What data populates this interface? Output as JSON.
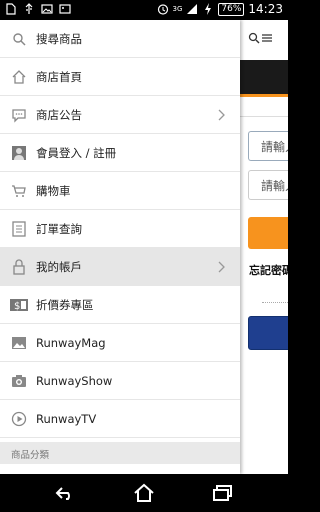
{
  "statusbar": {
    "time": "14:23",
    "battery": "76%",
    "network": "3G"
  },
  "drawer": {
    "items": [
      {
        "label": "搜尋商品",
        "icon": "search-icon"
      },
      {
        "label": "商店首頁",
        "icon": "home-icon"
      },
      {
        "label": "商店公告",
        "icon": "chat-icon"
      },
      {
        "label": "會員登入 / 註冊",
        "icon": "user-icon"
      },
      {
        "label": "購物車",
        "icon": "cart-icon"
      },
      {
        "label": "訂單查詢",
        "icon": "list-icon"
      },
      {
        "label": "我的帳戶",
        "icon": "lock-icon"
      },
      {
        "label": "折價券專區",
        "icon": "coupon-icon"
      },
      {
        "label": "RunwayMag",
        "icon": "image-icon"
      },
      {
        "label": "RunwayShow",
        "icon": "camera-icon"
      },
      {
        "label": "RunwayTV",
        "icon": "play-icon"
      }
    ],
    "section_label": "商品分類"
  },
  "behind": {
    "field1_placeholder": "請輸入",
    "field2_placeholder": "請輸入",
    "forgot_label": "忘記密碼"
  },
  "colors": {
    "accent": "#f7931e",
    "primary_button": "#1f3f8f",
    "active_row": "#e6e6e6"
  }
}
